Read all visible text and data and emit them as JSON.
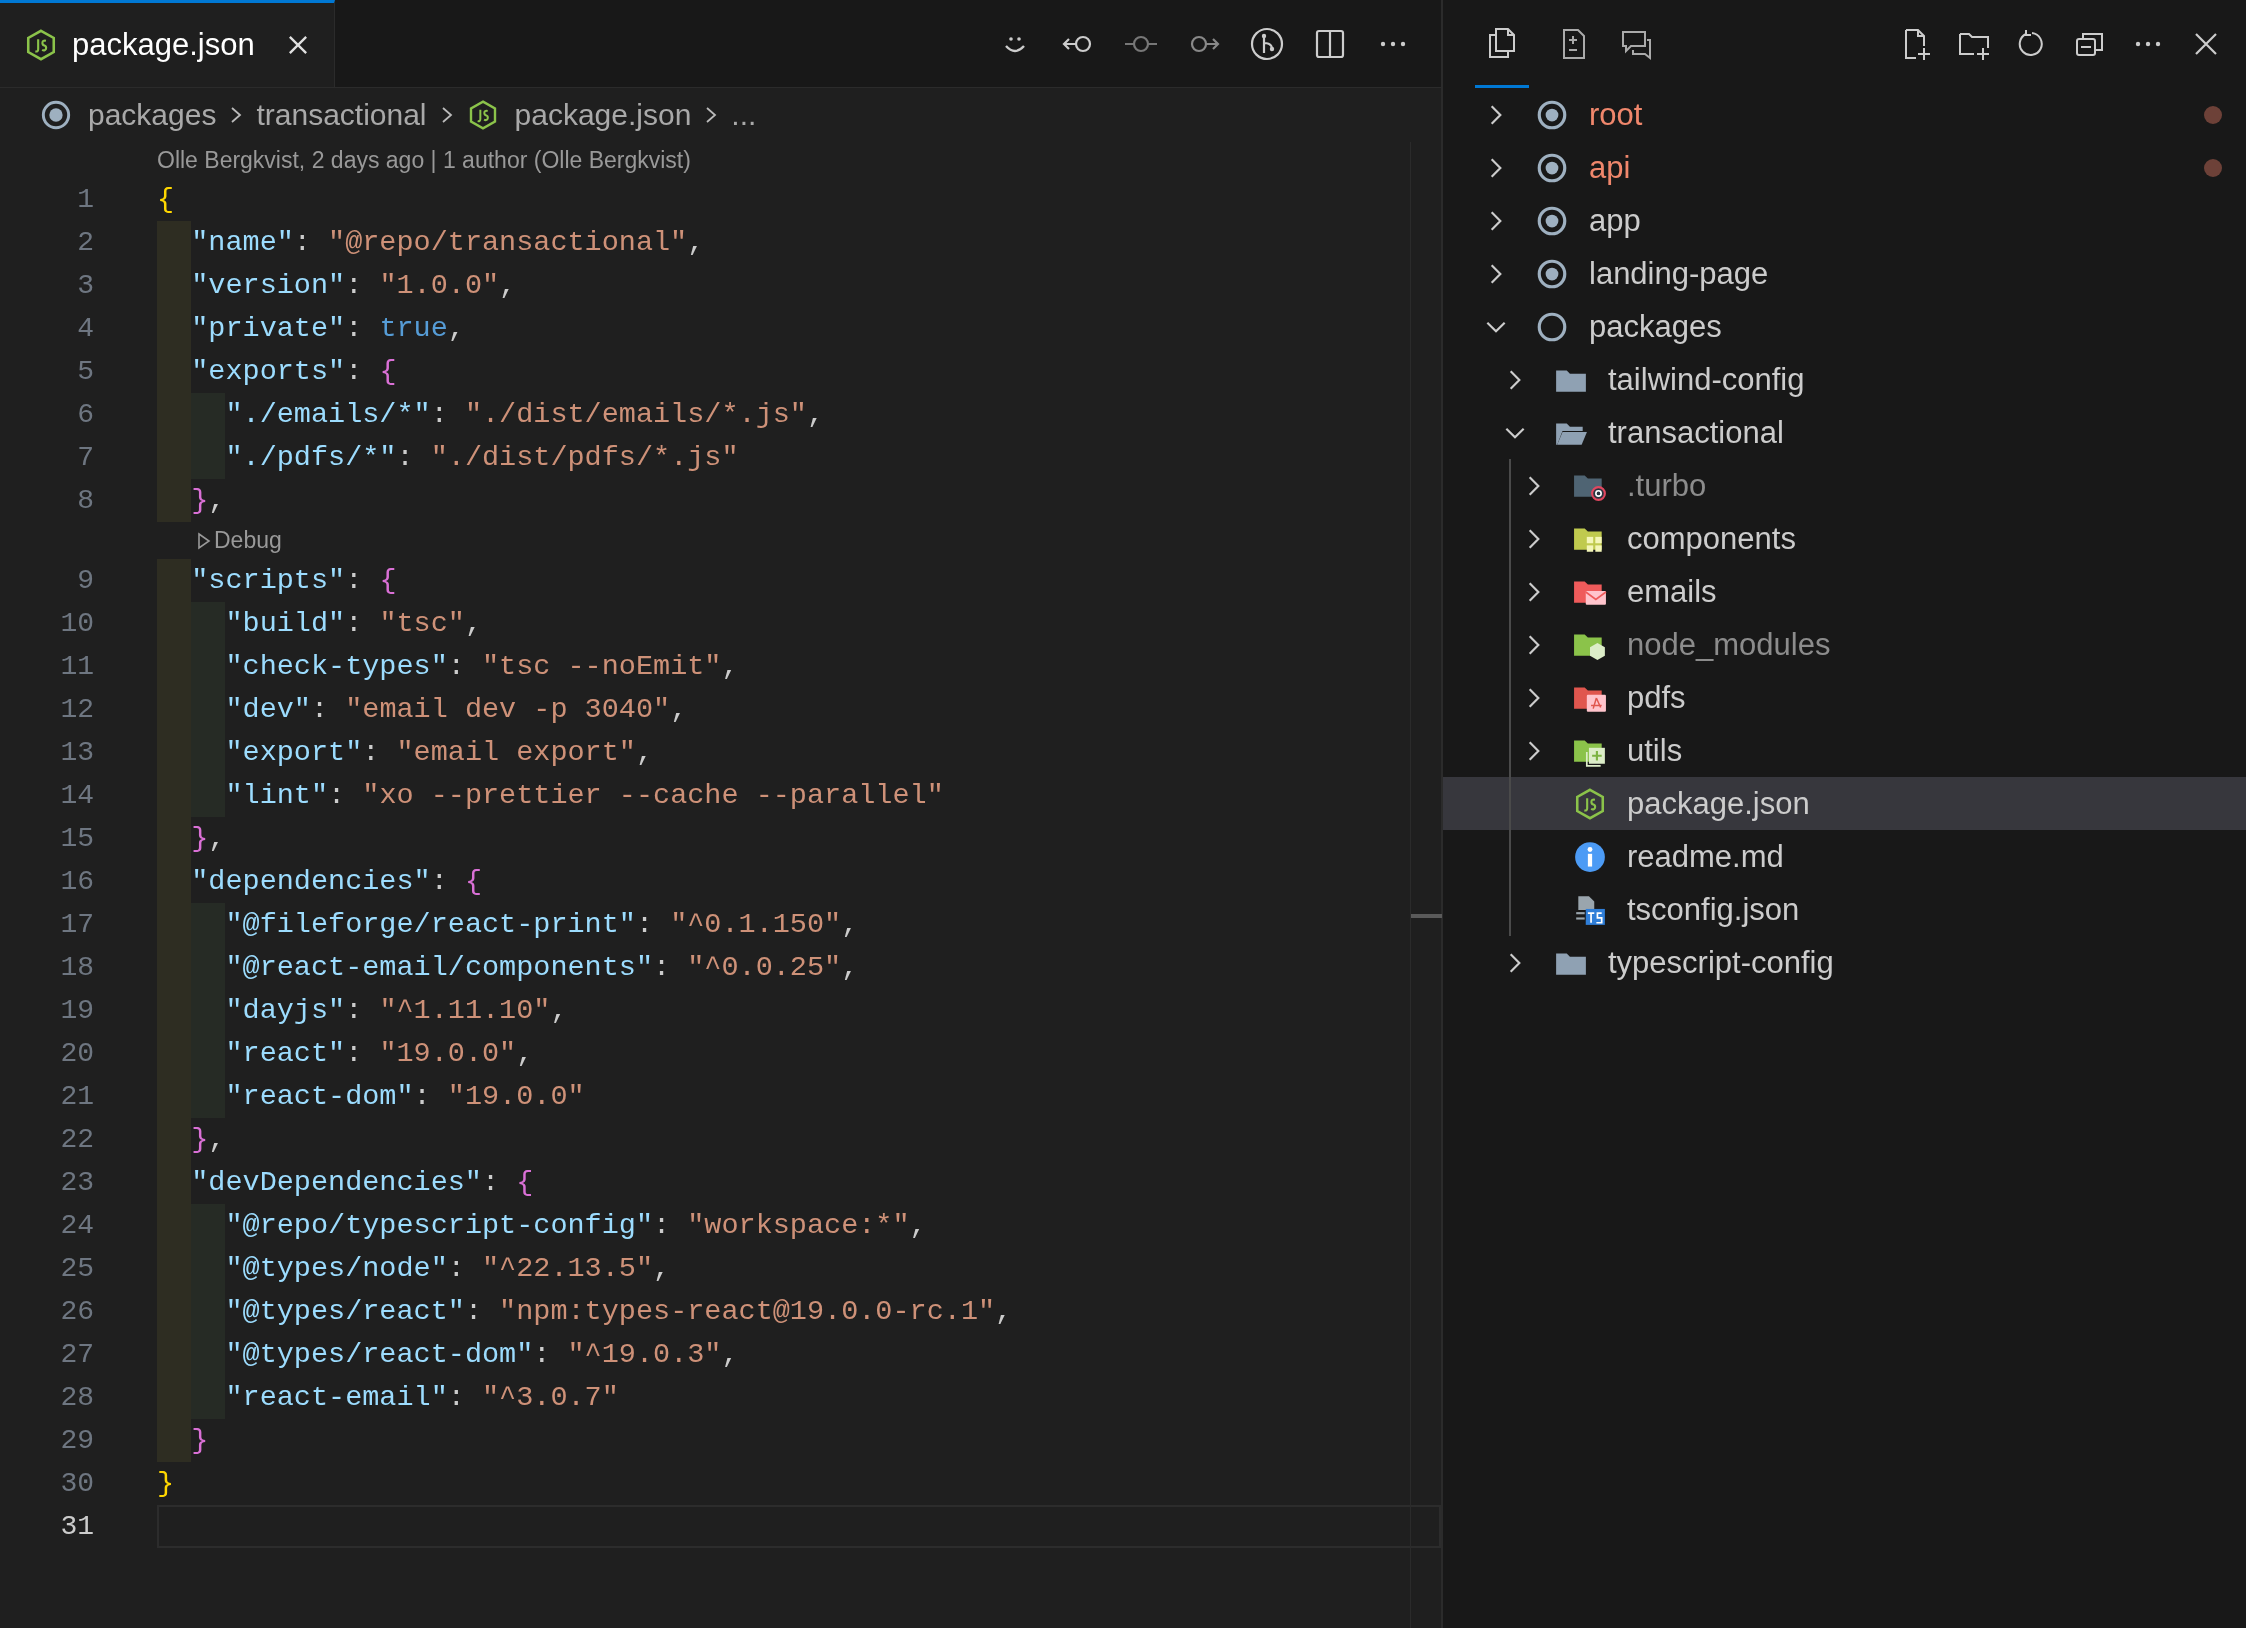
{
  "editor": {
    "tab": {
      "label": "package.json",
      "selected": true
    },
    "breadcrumb": {
      "items": [
        "packages",
        "transactional",
        "package.json"
      ],
      "more": "..."
    },
    "blame": "Olle Bergkvist, 2 days ago | 1 author (Olle Bergkvist)",
    "lines": [
      {
        "kind": "code",
        "number": "1",
        "current": false,
        "tokens": [
          {
            "kind": "brace",
            "text": "{"
          }
        ]
      },
      {
        "kind": "code",
        "number": "2",
        "current": false,
        "tokens": [
          {
            "kind": "key",
            "text": "  \"name\""
          },
          {
            "kind": "punct",
            "text": ": "
          },
          {
            "kind": "string",
            "text": "\"@repo/transactional\""
          },
          {
            "kind": "punct",
            "text": ","
          }
        ]
      },
      {
        "kind": "code",
        "number": "3",
        "current": false,
        "tokens": [
          {
            "kind": "key",
            "text": "  \"version\""
          },
          {
            "kind": "punct",
            "text": ": "
          },
          {
            "kind": "string",
            "text": "\"1.0.0\""
          },
          {
            "kind": "punct",
            "text": ","
          }
        ]
      },
      {
        "kind": "code",
        "number": "4",
        "current": false,
        "tokens": [
          {
            "kind": "key",
            "text": "  \"private\""
          },
          {
            "kind": "punct",
            "text": ": "
          },
          {
            "kind": "bool",
            "text": "true"
          },
          {
            "kind": "punct",
            "text": ","
          }
        ]
      },
      {
        "kind": "code",
        "number": "5",
        "current": false,
        "tokens": [
          {
            "kind": "key",
            "text": "  \"exports\""
          },
          {
            "kind": "punct",
            "text": ": "
          },
          {
            "kind": "nested",
            "text": "{"
          }
        ]
      },
      {
        "kind": "code",
        "number": "6",
        "current": false,
        "tokens": [
          {
            "kind": "key",
            "text": "    \"./emails/*\""
          },
          {
            "kind": "punct",
            "text": ": "
          },
          {
            "kind": "string",
            "text": "\"./dist/emails/*.js\""
          },
          {
            "kind": "punct",
            "text": ","
          }
        ]
      },
      {
        "kind": "code",
        "number": "7",
        "current": false,
        "tokens": [
          {
            "kind": "key",
            "text": "    \"./pdfs/*\""
          },
          {
            "kind": "punct",
            "text": ": "
          },
          {
            "kind": "string",
            "text": "\"./dist/pdfs/*.js\""
          }
        ]
      },
      {
        "kind": "code",
        "number": "8",
        "current": false,
        "tokens": [
          {
            "kind": "nested",
            "text": "  }"
          },
          {
            "kind": "punct",
            "text": ","
          }
        ]
      },
      {
        "kind": "codelens",
        "text": "Debug"
      },
      {
        "kind": "code",
        "number": "9",
        "current": false,
        "tokens": [
          {
            "kind": "key",
            "text": "  \"scripts\""
          },
          {
            "kind": "punct",
            "text": ": "
          },
          {
            "kind": "nested",
            "text": "{"
          }
        ]
      },
      {
        "kind": "code",
        "number": "10",
        "current": false,
        "tokens": [
          {
            "kind": "key",
            "text": "    \"build\""
          },
          {
            "kind": "punct",
            "text": ": "
          },
          {
            "kind": "string",
            "text": "\"tsc\""
          },
          {
            "kind": "punct",
            "text": ","
          }
        ]
      },
      {
        "kind": "code",
        "number": "11",
        "current": false,
        "tokens": [
          {
            "kind": "key",
            "text": "    \"check-types\""
          },
          {
            "kind": "punct",
            "text": ": "
          },
          {
            "kind": "string",
            "text": "\"tsc --noEmit\""
          },
          {
            "kind": "punct",
            "text": ","
          }
        ]
      },
      {
        "kind": "code",
        "number": "12",
        "current": false,
        "tokens": [
          {
            "kind": "key",
            "text": "    \"dev\""
          },
          {
            "kind": "punct",
            "text": ": "
          },
          {
            "kind": "string",
            "text": "\"email dev -p 3040\""
          },
          {
            "kind": "punct",
            "text": ","
          }
        ]
      },
      {
        "kind": "code",
        "number": "13",
        "current": false,
        "tokens": [
          {
            "kind": "key",
            "text": "    \"export\""
          },
          {
            "kind": "punct",
            "text": ": "
          },
          {
            "kind": "string",
            "text": "\"email export\""
          },
          {
            "kind": "punct",
            "text": ","
          }
        ]
      },
      {
        "kind": "code",
        "number": "14",
        "current": false,
        "tokens": [
          {
            "kind": "key",
            "text": "    \"lint\""
          },
          {
            "kind": "punct",
            "text": ": "
          },
          {
            "kind": "string",
            "text": "\"xo --prettier --cache --parallel\""
          }
        ]
      },
      {
        "kind": "code",
        "number": "15",
        "current": false,
        "tokens": [
          {
            "kind": "nested",
            "text": "  }"
          },
          {
            "kind": "punct",
            "text": ","
          }
        ]
      },
      {
        "kind": "code",
        "number": "16",
        "current": false,
        "tokens": [
          {
            "kind": "key",
            "text": "  \"dependencies\""
          },
          {
            "kind": "punct",
            "text": ": "
          },
          {
            "kind": "nested",
            "text": "{"
          }
        ]
      },
      {
        "kind": "code",
        "number": "17",
        "current": false,
        "tokens": [
          {
            "kind": "key",
            "text": "    \"@fileforge/react-print\""
          },
          {
            "kind": "punct",
            "text": ": "
          },
          {
            "kind": "string",
            "text": "\"^0.1.150\""
          },
          {
            "kind": "punct",
            "text": ","
          }
        ]
      },
      {
        "kind": "code",
        "number": "18",
        "current": false,
        "tokens": [
          {
            "kind": "key",
            "text": "    \"@react-email/components\""
          },
          {
            "kind": "punct",
            "text": ": "
          },
          {
            "kind": "string",
            "text": "\"^0.0.25\""
          },
          {
            "kind": "punct",
            "text": ","
          }
        ]
      },
      {
        "kind": "code",
        "number": "19",
        "current": false,
        "tokens": [
          {
            "kind": "key",
            "text": "    \"dayjs\""
          },
          {
            "kind": "punct",
            "text": ": "
          },
          {
            "kind": "string",
            "text": "\"^1.11.10\""
          },
          {
            "kind": "punct",
            "text": ","
          }
        ]
      },
      {
        "kind": "code",
        "number": "20",
        "current": false,
        "tokens": [
          {
            "kind": "key",
            "text": "    \"react\""
          },
          {
            "kind": "punct",
            "text": ": "
          },
          {
            "kind": "string",
            "text": "\"19.0.0\""
          },
          {
            "kind": "punct",
            "text": ","
          }
        ]
      },
      {
        "kind": "code",
        "number": "21",
        "current": false,
        "tokens": [
          {
            "kind": "key",
            "text": "    \"react-dom\""
          },
          {
            "kind": "punct",
            "text": ": "
          },
          {
            "kind": "string",
            "text": "\"19.0.0\""
          }
        ]
      },
      {
        "kind": "code",
        "number": "22",
        "current": false,
        "tokens": [
          {
            "kind": "nested",
            "text": "  }"
          },
          {
            "kind": "punct",
            "text": ","
          }
        ]
      },
      {
        "kind": "code",
        "number": "23",
        "current": false,
        "tokens": [
          {
            "kind": "key",
            "text": "  \"devDependencies\""
          },
          {
            "kind": "punct",
            "text": ": "
          },
          {
            "kind": "nested",
            "text": "{"
          }
        ]
      },
      {
        "kind": "code",
        "number": "24",
        "current": false,
        "tokens": [
          {
            "kind": "key",
            "text": "    \"@repo/typescript-config\""
          },
          {
            "kind": "punct",
            "text": ": "
          },
          {
            "kind": "string",
            "text": "\"workspace:*\""
          },
          {
            "kind": "punct",
            "text": ","
          }
        ]
      },
      {
        "kind": "code",
        "number": "25",
        "current": false,
        "tokens": [
          {
            "kind": "key",
            "text": "    \"@types/node\""
          },
          {
            "kind": "punct",
            "text": ": "
          },
          {
            "kind": "string",
            "text": "\"^22.13.5\""
          },
          {
            "kind": "punct",
            "text": ","
          }
        ]
      },
      {
        "kind": "code",
        "number": "26",
        "current": false,
        "tokens": [
          {
            "kind": "key",
            "text": "    \"@types/react\""
          },
          {
            "kind": "punct",
            "text": ": "
          },
          {
            "kind": "string",
            "text": "\"npm:types-react@19.0.0-rc.1\""
          },
          {
            "kind": "punct",
            "text": ","
          }
        ]
      },
      {
        "kind": "code",
        "number": "27",
        "current": false,
        "tokens": [
          {
            "kind": "key",
            "text": "    \"@types/react-dom\""
          },
          {
            "kind": "punct",
            "text": ": "
          },
          {
            "kind": "string",
            "text": "\"^19.0.3\""
          },
          {
            "kind": "punct",
            "text": ","
          }
        ]
      },
      {
        "kind": "code",
        "number": "28",
        "current": false,
        "tokens": [
          {
            "kind": "key",
            "text": "    \"react-email\""
          },
          {
            "kind": "punct",
            "text": ": "
          },
          {
            "kind": "string",
            "text": "\"^3.0.7\""
          }
        ]
      },
      {
        "kind": "code",
        "number": "29",
        "current": false,
        "tokens": [
          {
            "kind": "nested",
            "text": "  }"
          }
        ]
      },
      {
        "kind": "code",
        "number": "30",
        "current": false,
        "tokens": [
          {
            "kind": "brace",
            "text": "}"
          }
        ]
      },
      {
        "kind": "code",
        "number": "31",
        "current": true
      }
    ]
  },
  "explorer": {
    "tree": [
      {
        "label": "root",
        "kind": "workspace",
        "expanded": false,
        "modified": true,
        "ignored": false,
        "selected": false
      },
      {
        "label": "api",
        "kind": "workspace",
        "expanded": false,
        "modified": true,
        "ignored": false,
        "selected": false
      },
      {
        "label": "app",
        "kind": "workspace",
        "expanded": false,
        "modified": false,
        "ignored": false,
        "selected": false
      },
      {
        "label": "landing-page",
        "kind": "workspace",
        "expanded": false,
        "modified": false,
        "ignored": false,
        "selected": false
      },
      {
        "label": "packages",
        "kind": "workspace-empty",
        "expanded": true,
        "modified": false,
        "ignored": false,
        "selected": false,
        "children": [
          {
            "label": "tailwind-config",
            "kind": "folder",
            "expanded": false,
            "modified": false,
            "ignored": false,
            "selected": false
          },
          {
            "label": "transactional",
            "kind": "folder",
            "expanded": true,
            "modified": false,
            "ignored": false,
            "selected": false,
            "children": [
              {
                "label": ".turbo",
                "kind": "turbo-folder",
                "expanded": false,
                "modified": false,
                "ignored": true,
                "selected": false
              },
              {
                "label": "components",
                "kind": "components-folder",
                "expanded": false,
                "modified": false,
                "ignored": false,
                "selected": false
              },
              {
                "label": "emails",
                "kind": "mail-folder",
                "expanded": false,
                "modified": false,
                "ignored": false,
                "selected": false
              },
              {
                "label": "node_modules",
                "kind": "node-folder",
                "expanded": false,
                "modified": false,
                "ignored": true,
                "selected": false
              },
              {
                "label": "pdfs",
                "kind": "pdf-folder",
                "expanded": false,
                "modified": false,
                "ignored": false,
                "selected": false
              },
              {
                "label": "utils",
                "kind": "utils-folder",
                "expanded": false,
                "modified": false,
                "ignored": false,
                "selected": false
              },
              {
                "label": "package.json",
                "kind": "node-file",
                "modified": false,
                "ignored": false,
                "selected": true
              },
              {
                "label": "readme.md",
                "kind": "info-file",
                "modified": false,
                "ignored": false,
                "selected": false
              },
              {
                "label": "tsconfig.json",
                "kind": "ts-file",
                "modified": false,
                "ignored": false,
                "selected": false
              }
            ]
          },
          {
            "label": "typescript-config",
            "kind": "folder",
            "expanded": false,
            "modified": false,
            "ignored": false,
            "selected": false
          }
        ]
      }
    ]
  }
}
